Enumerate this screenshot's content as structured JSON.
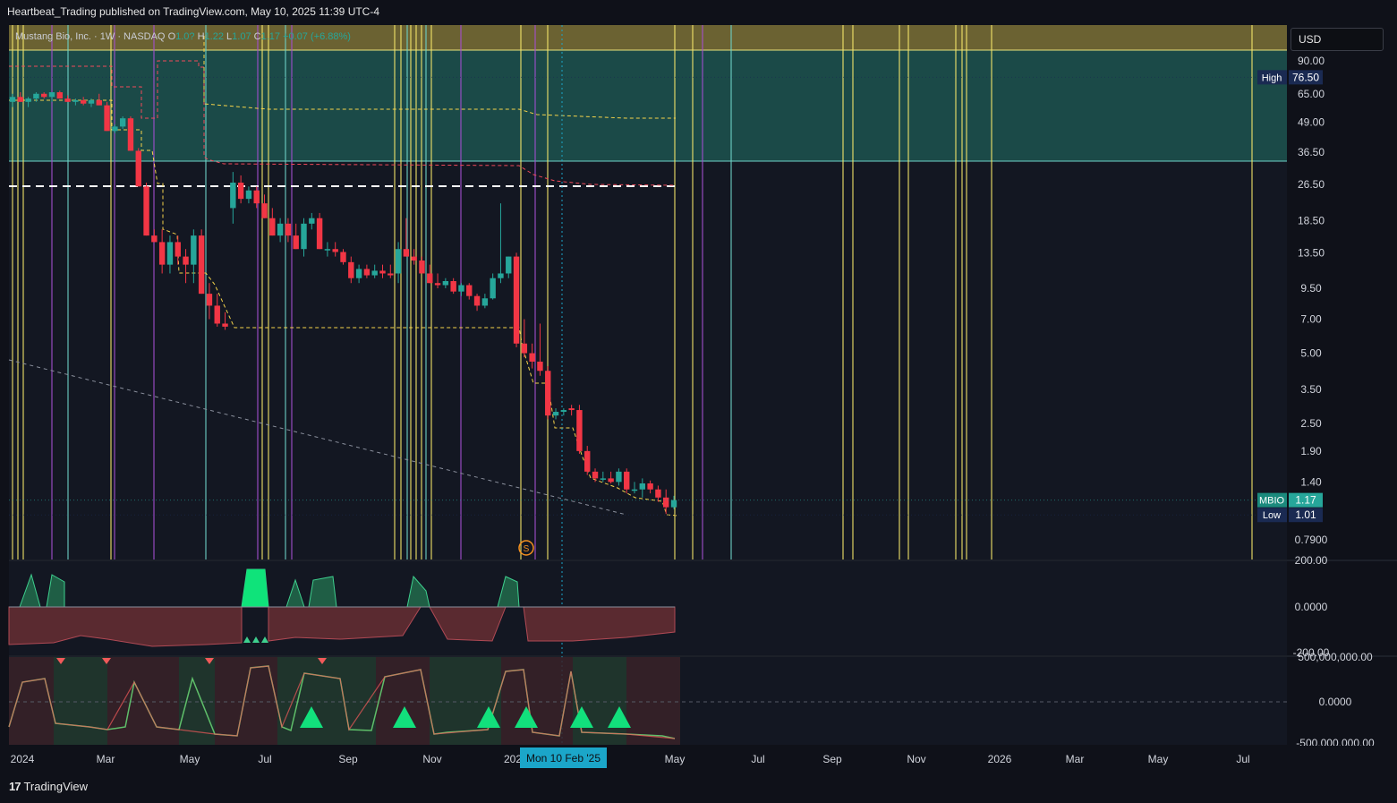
{
  "header": {
    "published": "Heartbeat_Trading published on TradingView.com, May 10, 2025 11:39 UTC-4"
  },
  "legend": {
    "symbol_desc": "Mustang Bio, Inc. · 1W · NASDAQ",
    "o_label": "O",
    "o_value": "1.0?",
    "h_label": "H",
    "h_value": "1.22",
    "l_label": "L",
    "l_value": "1.07",
    "c_label": "C",
    "c_value": "1.17",
    "change": "+0.07 (+6.88%)"
  },
  "currency": "USD",
  "footer": {
    "brand": "TradingView"
  },
  "crosshair_date": "Mon 10 Feb '25",
  "price_badges": {
    "high": {
      "label": "High",
      "value": "76.50"
    },
    "last": {
      "label": "MBIO",
      "value": "1.17"
    },
    "low": {
      "label": "Low",
      "value": "1.01"
    }
  },
  "colors": {
    "up": "#26a69a",
    "down": "#f23645",
    "bg": "#131722",
    "zone_top": "#6b6232",
    "zone_mid": "#1b4a48",
    "yellow_line": "#f5e66a",
    "purple_line": "#a44fd0",
    "cyan_line": "#6fd3c8"
  },
  "chart_data": [
    {
      "type": "candlestick",
      "title": "Mustang Bio, Inc. · 1W · NASDAQ",
      "y_scale": "log",
      "y_ticks": [
        "90.00",
        "65.00",
        "49.00",
        "36.50",
        "26.50",
        "18.50",
        "13.50",
        "9.50",
        "7.00",
        "5.00",
        "3.50",
        "2.50",
        "1.90",
        "1.40",
        "0.7900"
      ],
      "y_tick_values": [
        90,
        65,
        49,
        36.5,
        26.5,
        18.5,
        13.5,
        9.5,
        7,
        5,
        3.5,
        2.5,
        1.9,
        1.4,
        0.79
      ],
      "x_ticks": [
        "2024",
        "Mar",
        "May",
        "Jul",
        "Sep",
        "Nov",
        "202",
        "May",
        "Jul",
        "Sep",
        "Nov",
        "2026",
        "Mar",
        "May",
        "Jul"
      ],
      "candles": [
        {
          "o": 60,
          "h": 65,
          "l": 57,
          "c": 63
        },
        {
          "o": 63,
          "h": 66,
          "l": 60,
          "c": 60
        },
        {
          "o": 60,
          "h": 63,
          "l": 57,
          "c": 62
        },
        {
          "o": 62,
          "h": 66,
          "l": 60,
          "c": 65
        },
        {
          "o": 65,
          "h": 66,
          "l": 62,
          "c": 63
        },
        {
          "o": 63,
          "h": 66,
          "l": 60,
          "c": 66
        },
        {
          "o": 66,
          "h": 67,
          "l": 62,
          "c": 62
        },
        {
          "o": 62,
          "h": 64,
          "l": 60,
          "c": 60
        },
        {
          "o": 60,
          "h": 62,
          "l": 58,
          "c": 61
        },
        {
          "o": 61,
          "h": 63,
          "l": 58,
          "c": 59
        },
        {
          "o": 59,
          "h": 62,
          "l": 57,
          "c": 61
        },
        {
          "o": 61,
          "h": 65,
          "l": 58,
          "c": 58
        },
        {
          "o": 58,
          "h": 60,
          "l": 45,
          "c": 45
        },
        {
          "o": 45,
          "h": 48,
          "l": 44,
          "c": 47
        },
        {
          "o": 47,
          "h": 52,
          "l": 46,
          "c": 51
        },
        {
          "o": 51,
          "h": 52,
          "l": 37,
          "c": 37
        },
        {
          "o": 37,
          "h": 38,
          "l": 26,
          "c": 26
        },
        {
          "o": 26,
          "h": 27,
          "l": 16,
          "c": 16
        },
        {
          "o": 16,
          "h": 17,
          "l": 15,
          "c": 15
        },
        {
          "o": 15,
          "h": 17,
          "l": 11,
          "c": 12
        },
        {
          "o": 12,
          "h": 16,
          "l": 11,
          "c": 15
        },
        {
          "o": 15,
          "h": 16,
          "l": 12,
          "c": 13
        },
        {
          "o": 13,
          "h": 14,
          "l": 10,
          "c": 12
        },
        {
          "o": 12,
          "h": 17,
          "l": 10,
          "c": 16
        },
        {
          "o": 16,
          "h": 17,
          "l": 9,
          "c": 9
        },
        {
          "o": 9,
          "h": 10,
          "l": 7,
          "c": 8
        },
        {
          "o": 8,
          "h": 9,
          "l": 6.5,
          "c": 6.7
        },
        {
          "o": 6.7,
          "h": 7.5,
          "l": 6.3,
          "c": 6.5
        },
        {
          "o": 21,
          "h": 30,
          "l": 18,
          "c": 27
        },
        {
          "o": 27,
          "h": 29,
          "l": 22,
          "c": 23
        },
        {
          "o": 23,
          "h": 26,
          "l": 22,
          "c": 25
        },
        {
          "o": 25,
          "h": 26,
          "l": 21,
          "c": 22
        },
        {
          "o": 22,
          "h": 24,
          "l": 19,
          "c": 19
        },
        {
          "o": 19,
          "h": 21,
          "l": 16,
          "c": 16
        },
        {
          "o": 16,
          "h": 19,
          "l": 15,
          "c": 18
        },
        {
          "o": 18,
          "h": 19,
          "l": 15,
          "c": 16
        },
        {
          "o": 16,
          "h": 18,
          "l": 14,
          "c": 14
        },
        {
          "o": 14,
          "h": 19,
          "l": 13,
          "c": 18
        },
        {
          "o": 18,
          "h": 20,
          "l": 17,
          "c": 19
        },
        {
          "o": 19,
          "h": 20,
          "l": 14,
          "c": 14
        },
        {
          "o": 14,
          "h": 15,
          "l": 13,
          "c": 14
        },
        {
          "o": 14,
          "h": 15,
          "l": 13,
          "c": 13.6
        },
        {
          "o": 13.6,
          "h": 14,
          "l": 12,
          "c": 12.3
        },
        {
          "o": 12.3,
          "h": 13,
          "l": 10,
          "c": 10.5
        },
        {
          "o": 10.5,
          "h": 12,
          "l": 10,
          "c": 11.5
        },
        {
          "o": 11.5,
          "h": 12,
          "l": 10.5,
          "c": 10.8
        },
        {
          "o": 10.8,
          "h": 12,
          "l": 10.5,
          "c": 11.3
        },
        {
          "o": 11.3,
          "h": 12,
          "l": 10.5,
          "c": 11
        },
        {
          "o": 11,
          "h": 12,
          "l": 10.5,
          "c": 10.8
        },
        {
          "o": 11,
          "h": 15,
          "l": 10,
          "c": 14
        },
        {
          "o": 14,
          "h": 19,
          "l": 13,
          "c": 13
        },
        {
          "o": 13,
          "h": 14,
          "l": 12,
          "c": 12.5
        },
        {
          "o": 12.5,
          "h": 13,
          "l": 11,
          "c": 11
        },
        {
          "o": 11,
          "h": 12,
          "l": 10,
          "c": 10
        },
        {
          "o": 10,
          "h": 11,
          "l": 9.5,
          "c": 9.8
        },
        {
          "o": 9.8,
          "h": 10.5,
          "l": 9.5,
          "c": 10.2
        },
        {
          "o": 10.2,
          "h": 10.5,
          "l": 9,
          "c": 9.2
        },
        {
          "o": 9.2,
          "h": 10,
          "l": 8.8,
          "c": 9.8
        },
        {
          "o": 9.8,
          "h": 10,
          "l": 8.5,
          "c": 8.8
        },
        {
          "o": 8.8,
          "h": 9,
          "l": 7.6,
          "c": 8
        },
        {
          "o": 8,
          "h": 9,
          "l": 7.8,
          "c": 8.6
        },
        {
          "o": 8.6,
          "h": 11,
          "l": 8.5,
          "c": 10.5
        },
        {
          "o": 10.5,
          "h": 22,
          "l": 10,
          "c": 11
        },
        {
          "o": 11,
          "h": 13,
          "l": 10.5,
          "c": 13
        },
        {
          "o": 13,
          "h": 13.5,
          "l": 5.3,
          "c": 5.5
        },
        {
          "o": 5.5,
          "h": 7,
          "l": 4.8,
          "c": 5
        },
        {
          "o": 5,
          "h": 5.5,
          "l": 4.3,
          "c": 4.6
        },
        {
          "o": 4.6,
          "h": 6.7,
          "l": 4,
          "c": 4.2
        },
        {
          "o": 4.2,
          "h": 4.4,
          "l": 2.6,
          "c": 2.7
        },
        {
          "o": 2.7,
          "h": 2.9,
          "l": 2.6,
          "c": 2.8
        },
        {
          "o": 2.8,
          "h": 2.9,
          "l": 2.7,
          "c": 2.85
        },
        {
          "o": 2.9,
          "h": 3,
          "l": 2.7,
          "c": 2.85
        },
        {
          "o": 2.85,
          "h": 3,
          "l": 1.85,
          "c": 1.9
        },
        {
          "o": 1.9,
          "h": 2,
          "l": 1.5,
          "c": 1.55
        },
        {
          "o": 1.55,
          "h": 1.6,
          "l": 1.4,
          "c": 1.45
        },
        {
          "o": 1.45,
          "h": 1.55,
          "l": 1.4,
          "c": 1.45
        },
        {
          "o": 1.45,
          "h": 1.55,
          "l": 1.38,
          "c": 1.4
        },
        {
          "o": 1.4,
          "h": 1.6,
          "l": 1.35,
          "c": 1.55
        },
        {
          "o": 1.55,
          "h": 1.6,
          "l": 1.25,
          "c": 1.3
        },
        {
          "o": 1.3,
          "h": 1.4,
          "l": 1.25,
          "c": 1.3
        },
        {
          "o": 1.3,
          "h": 1.45,
          "l": 1.2,
          "c": 1.38
        },
        {
          "o": 1.38,
          "h": 1.42,
          "l": 1.25,
          "c": 1.3
        },
        {
          "o": 1.3,
          "h": 1.35,
          "l": 1.15,
          "c": 1.2
        },
        {
          "o": 1.2,
          "h": 1.3,
          "l": 1.02,
          "c": 1.09
        },
        {
          "o": 1.09,
          "h": 1.22,
          "l": 1.07,
          "c": 1.17
        }
      ],
      "levels": [
        {
          "label": "High",
          "value": 76.5
        },
        {
          "label": "Low",
          "value": 1.01
        },
        {
          "label": "MBIO",
          "value": 1.17
        }
      ]
    },
    {
      "type": "area",
      "title": "",
      "y_ticks": [
        "200.00",
        "0.0000",
        "-200.00"
      ],
      "y_tick_values": [
        200,
        0,
        -200
      ]
    },
    {
      "type": "line",
      "title": "",
      "y_ticks": [
        "500,000,000.00",
        "0.0000",
        "-500,000,000.00"
      ],
      "y_tick_values": [
        500000000,
        0,
        -500000000
      ]
    }
  ]
}
